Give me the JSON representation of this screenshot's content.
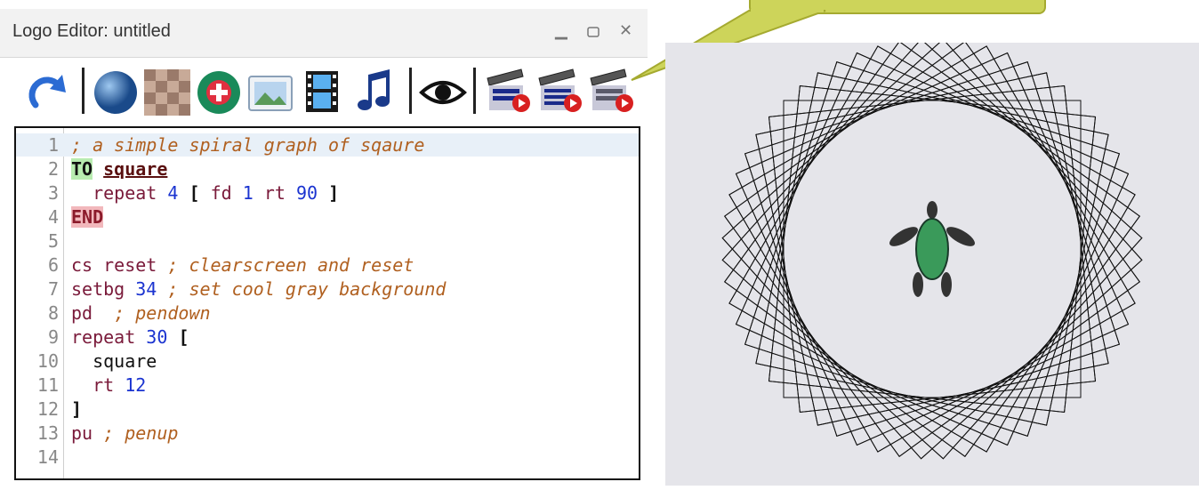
{
  "window": {
    "title": "Logo Editor: untitled",
    "controls": [
      "minimize-icon",
      "maximize-icon",
      "close-icon"
    ]
  },
  "toolbar": {
    "buttons": [
      "redo-icon",
      "sphere-icon",
      "texture-icon",
      "globe-add-icon",
      "image-icon",
      "film-icon",
      "music-icon",
      "eye-icon",
      "clapper-icon",
      "clapper-list-icon",
      "clapper-play-icon"
    ]
  },
  "editor": {
    "lines": [
      {
        "n": "1",
        "parts": [
          [
            "cmt",
            "; a simple spiral graph of sqaure"
          ]
        ]
      },
      {
        "n": "2",
        "parts": [
          [
            "kw-to",
            "TO"
          ],
          [
            "plain",
            " "
          ],
          [
            "proc",
            "square"
          ]
        ]
      },
      {
        "n": "3",
        "parts": [
          [
            "plain",
            "  "
          ],
          [
            "cmd",
            "repeat"
          ],
          [
            "plain",
            " "
          ],
          [
            "num",
            "4"
          ],
          [
            "plain",
            " "
          ],
          [
            "br",
            "["
          ],
          [
            "plain",
            " "
          ],
          [
            "cmd",
            "fd"
          ],
          [
            "plain",
            " "
          ],
          [
            "num",
            "1"
          ],
          [
            "plain",
            " "
          ],
          [
            "cmd",
            "rt"
          ],
          [
            "plain",
            " "
          ],
          [
            "num",
            "90"
          ],
          [
            "plain",
            " "
          ],
          [
            "br",
            "]"
          ]
        ]
      },
      {
        "n": "4",
        "parts": [
          [
            "kw-end",
            "END"
          ]
        ]
      },
      {
        "n": "5",
        "parts": []
      },
      {
        "n": "6",
        "parts": [
          [
            "cmd",
            "cs reset"
          ],
          [
            "plain",
            " "
          ],
          [
            "cmt",
            "; clearscreen and reset"
          ]
        ]
      },
      {
        "n": "7",
        "parts": [
          [
            "cmd",
            "setbg"
          ],
          [
            "plain",
            " "
          ],
          [
            "num",
            "34"
          ],
          [
            "plain",
            " "
          ],
          [
            "cmt",
            "; set cool gray background"
          ]
        ]
      },
      {
        "n": "8",
        "parts": [
          [
            "cmd",
            "pd"
          ],
          [
            "plain",
            "  "
          ],
          [
            "cmt",
            "; pendown"
          ]
        ]
      },
      {
        "n": "9",
        "parts": [
          [
            "cmd",
            "repeat"
          ],
          [
            "plain",
            " "
          ],
          [
            "num",
            "30"
          ],
          [
            "plain",
            " "
          ],
          [
            "br",
            "["
          ]
        ]
      },
      {
        "n": "10",
        "parts": [
          [
            "plain",
            "  square"
          ]
        ]
      },
      {
        "n": "11",
        "parts": [
          [
            "plain",
            "  "
          ],
          [
            "cmd",
            "rt"
          ],
          [
            "plain",
            " "
          ],
          [
            "num",
            "12"
          ]
        ]
      },
      {
        "n": "12",
        "parts": [
          [
            "br",
            "]"
          ]
        ]
      },
      {
        "n": "13",
        "parts": [
          [
            "cmd",
            "pu"
          ],
          [
            "plain",
            " "
          ],
          [
            "cmt",
            "; penup"
          ]
        ]
      },
      {
        "n": "14",
        "parts": []
      }
    ]
  },
  "canvas": {
    "background": "#e5e5ea",
    "squares": 30,
    "rotation_step_deg": 12,
    "turtle_color": "#3a9a5a"
  }
}
